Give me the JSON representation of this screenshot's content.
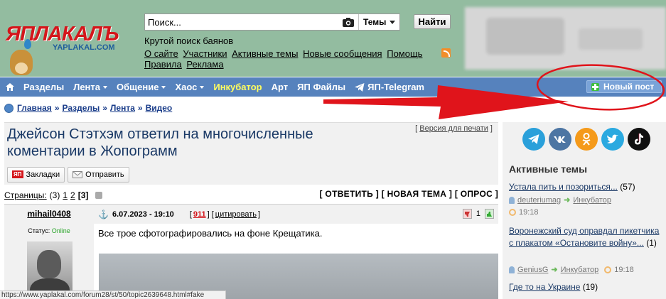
{
  "logo": {
    "text": "ЯПЛАКАЛЪ",
    "sub": "YAPLAKAL.COM"
  },
  "search": {
    "placeholder": "Поиск...",
    "scope": "Темы",
    "button": "Найти"
  },
  "tagline": "Крутой поиск баянов",
  "top_links": [
    "О сайте",
    "Участники",
    "Активные темы",
    "Новые сообщения",
    "Помощь",
    "Правила",
    "Реклама"
  ],
  "nav": {
    "items": [
      "Разделы",
      "Лента",
      "Общение",
      "Хаос",
      "Инкубатор",
      "Арт",
      "ЯП Файлы",
      "ЯП-Telegram"
    ],
    "new_post": "Новый пост"
  },
  "breadcrumb": [
    "Главная",
    "Разделы",
    "Лента",
    "Видео"
  ],
  "post": {
    "title": "Джейсон Стэтхэм ответил на многочисленные коментарии в Жопограмм",
    "print_version": "Версия для печати",
    "bookmarks": "Закладки",
    "send": "Отправить",
    "yap_badge": "ЯП",
    "pages_label": "Страницы:",
    "pages_count": "(3)",
    "pages": [
      "1",
      "2",
      "[3]"
    ],
    "topic_actions": "[ ОТВЕТИТЬ ] [ НОВАЯ ТЕМА ] [ ОПРОС ]",
    "author": "mihail0408",
    "status_label": "Статус:",
    "status_value": "Online",
    "date": "6.07.2023 - 19:10",
    "rating": "911",
    "quote": "цитировать",
    "votes": "1",
    "text": "Все трое сфотографировались на фоне Крещатика."
  },
  "sidebar": {
    "social": [
      "tg",
      "vk",
      "ok",
      "tw",
      "tt"
    ],
    "active_title": "Активные темы",
    "topics": [
      {
        "title": "Устала пить и позориться...",
        "count": "(57)",
        "user": "deuteriumag",
        "section": "Инкубатор",
        "time": "19:18"
      },
      {
        "title": "Воронежский суд оправдал пикетчика с плакатом «Остановите войну»...",
        "count": "(1)",
        "user": "GeniusG",
        "section": "Инкубатор",
        "time": "19:18"
      },
      {
        "title": "Где то на Украине",
        "count": "(19)"
      }
    ]
  },
  "status_bar": "https://www.yaplakal.com/forum28/st/50/topic2639648.html#fake",
  "colors": {
    "header_bg": "#93bca0",
    "navbar_bg": "#5682bd",
    "accent_red": "#d4161b",
    "annotation_red": "#e0141b"
  }
}
